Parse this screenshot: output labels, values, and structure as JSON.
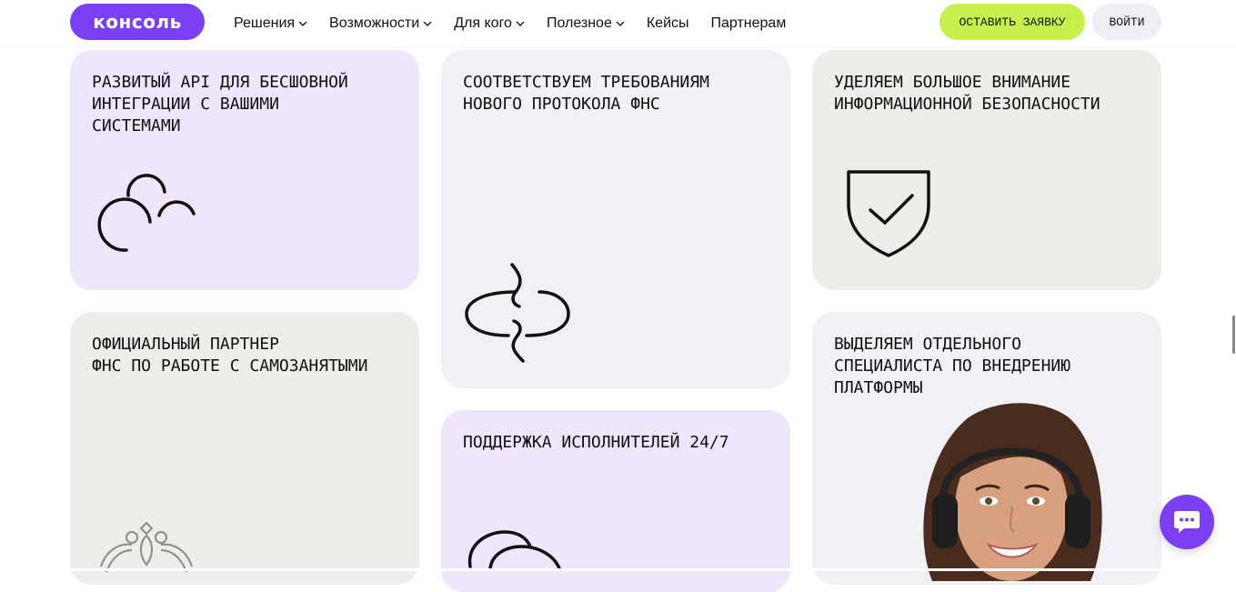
{
  "header": {
    "logo": "консоль",
    "nav": [
      {
        "label": "Решения",
        "dropdown": true
      },
      {
        "label": "Возможности",
        "dropdown": true
      },
      {
        "label": "Для кого",
        "dropdown": true
      },
      {
        "label": "Полезное",
        "dropdown": true
      },
      {
        "label": "Кейсы",
        "dropdown": false
      },
      {
        "label": "Партнерам",
        "dropdown": false
      }
    ],
    "apply_label": "ОСТАВИТЬ ЗАЯВКУ",
    "login_label": "ВОЙТИ"
  },
  "cards": {
    "api": {
      "title": "Развитый API для бесшовной\nинтеграции с вашими\nсистемами",
      "icon": "clouds-icon"
    },
    "fns_protocol": {
      "title": "Соответствуем требованиям\nнового протокола ФНС",
      "icon": "sync-arrows-icon"
    },
    "security": {
      "title": "Уделяем большое внимание\nинформационной безопасности",
      "icon": "shield-check-icon"
    },
    "partner": {
      "title": "Официальный партнер\nФНС по работе с самозанятыми",
      "icon": "coat-of-arms-emblem"
    },
    "support": {
      "title": "Поддержка исполнителей 24/7",
      "icon": "chat-bubbles-icon"
    },
    "specialist": {
      "title": "Выделяем отдельного\nспециалиста по внедрению\nплатформы",
      "image": "support-specialist-photo"
    }
  },
  "colors": {
    "brand": "#7b3ff2",
    "accent": "#c8f04d",
    "card_purple": "#efe6fc",
    "card_green": "#ebeee9",
    "card_grey": "#f1f0f5"
  },
  "chat": {
    "icon": "chat-icon"
  }
}
